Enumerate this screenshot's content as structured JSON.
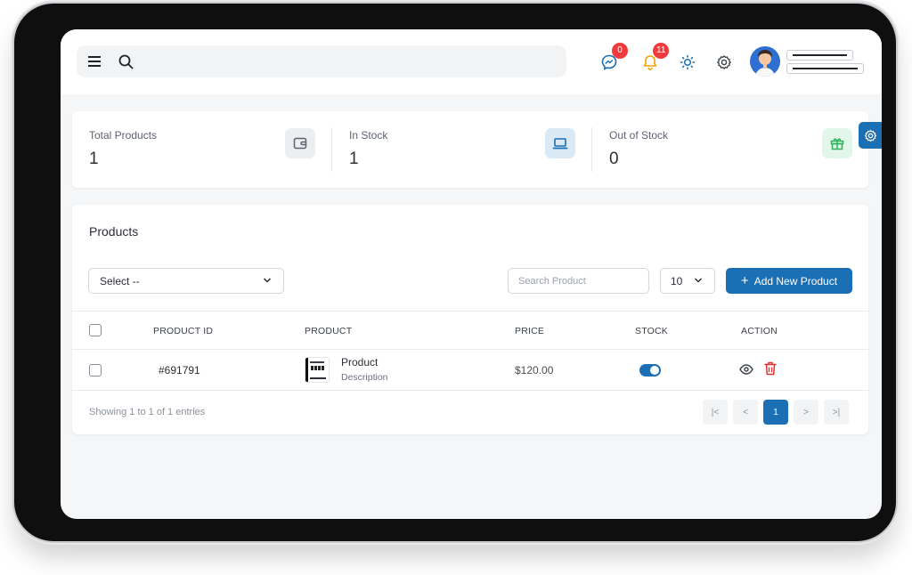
{
  "header": {
    "menu_icon": "menu-icon",
    "search_icon": "search-icon",
    "messages_badge": "0",
    "notifications_badge": "11",
    "theme_icon": "sun-icon",
    "settings_icon": "gear-icon"
  },
  "stats": [
    {
      "label": "Total Products",
      "value": "1",
      "icon": "wallet-icon"
    },
    {
      "label": "In Stock",
      "value": "1",
      "icon": "laptop-icon"
    },
    {
      "label": "Out of Stock",
      "value": "0",
      "icon": "gift-icon"
    }
  ],
  "products": {
    "title": "Products",
    "filter_select": "Select --",
    "search_placeholder": "Search Product",
    "page_size": "10",
    "add_button": "Add New Product",
    "columns": [
      "PRODUCT ID",
      "PRODUCT",
      "PRICE",
      "STOCK",
      "ACTION"
    ],
    "rows": [
      {
        "id": "#691791",
        "name": "Product",
        "description": "Description",
        "price": "$120.00",
        "in_stock": true
      }
    ],
    "footer_text": "Showing 1 to 1 of 1 entries",
    "pagination": {
      "first": "|<",
      "prev": "<",
      "current": "1",
      "next": ">",
      "last": ">|"
    }
  },
  "colors": {
    "primary": "#1a6fb5",
    "badge": "#ef3b3b",
    "danger": "#e03131",
    "bell": "#f59f00",
    "gift_bg": "#e3f6ea",
    "gift": "#2fb35a",
    "laptop_bg": "#dbe9f5"
  }
}
